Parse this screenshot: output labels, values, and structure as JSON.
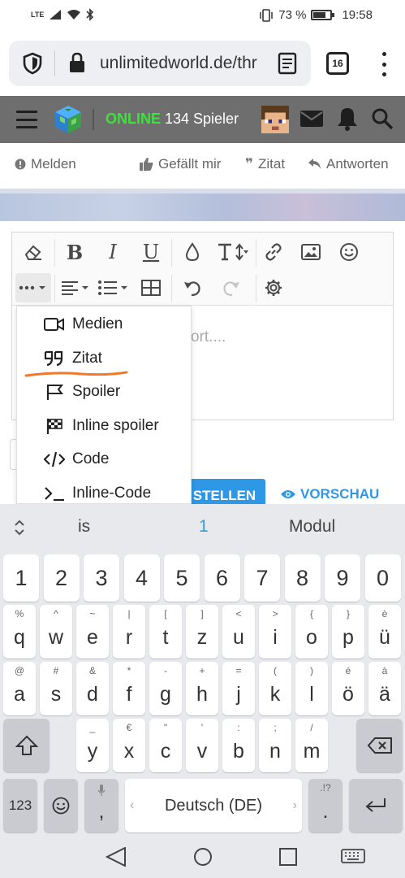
{
  "status_bar": {
    "network": "LTE",
    "battery": "73 %",
    "battery_level": 0.73,
    "time": "19:58"
  },
  "browser": {
    "url": "unlimitedworld.de/thr",
    "tab_count": "16",
    "icons": [
      "shield-icon",
      "lock-icon",
      "reader-mode-icon",
      "tabs-icon",
      "more-icon"
    ]
  },
  "site_header": {
    "online_label": "ONLINE",
    "players_text": "134 Spieler",
    "online_color": "#3be33b"
  },
  "post_actions": {
    "report": "Melden",
    "like": "Gefällt mir",
    "quote": "Zitat",
    "reply": "Antworten"
  },
  "editor": {
    "placeholder_fragment": "ort....",
    "toolbar_icons": [
      "eraser-icon",
      "bold-icon",
      "italic-icon",
      "underline-icon",
      "color-drop-icon",
      "text-size-icon",
      "link-icon",
      "image-icon",
      "smiley-icon",
      "more-options-icon",
      "align-icon",
      "list-icon",
      "table-icon",
      "undo-icon",
      "redo-icon",
      "settings-icon"
    ],
    "toolbar_glyphs": {
      "bold": "B",
      "italic": "I",
      "underline": "U"
    }
  },
  "dropdown_menu": {
    "items": [
      {
        "label": "Medien",
        "icon": "video-icon"
      },
      {
        "label": "Zitat",
        "icon": "quote-icon"
      },
      {
        "label": "Spoiler",
        "icon": "flag-icon"
      },
      {
        "label": "Inline spoiler",
        "icon": "checkered-flag-icon"
      },
      {
        "label": "Code",
        "icon": "code-icon"
      },
      {
        "label": "Inline-Code",
        "icon": "terminal-icon"
      }
    ],
    "highlight_color": "#f07a2a"
  },
  "form_buttons": {
    "submit_fragment": "STELLEN",
    "preview": "VORSCHAU",
    "accent_color": "#2f98e6"
  },
  "keyboard": {
    "suggestions": [
      "is",
      "1",
      "Modul"
    ],
    "number_row": [
      "1",
      "2",
      "3",
      "4",
      "5",
      "6",
      "7",
      "8",
      "9",
      "0"
    ],
    "row1": [
      {
        "main": "q",
        "sub": "%"
      },
      {
        "main": "w",
        "sub": "^"
      },
      {
        "main": "e",
        "sub": "~"
      },
      {
        "main": "r",
        "sub": "|"
      },
      {
        "main": "t",
        "sub": "["
      },
      {
        "main": "z",
        "sub": "]"
      },
      {
        "main": "u",
        "sub": "<"
      },
      {
        "main": "i",
        "sub": ">"
      },
      {
        "main": "o",
        "sub": "{"
      },
      {
        "main": "p",
        "sub": "}"
      },
      {
        "main": "ü",
        "sub": "è"
      }
    ],
    "row2": [
      {
        "main": "a",
        "sub": "@"
      },
      {
        "main": "s",
        "sub": "#"
      },
      {
        "main": "d",
        "sub": "&"
      },
      {
        "main": "f",
        "sub": "*"
      },
      {
        "main": "g",
        "sub": "-"
      },
      {
        "main": "h",
        "sub": "+"
      },
      {
        "main": "j",
        "sub": "="
      },
      {
        "main": "k",
        "sub": "("
      },
      {
        "main": "l",
        "sub": ")"
      },
      {
        "main": "ö",
        "sub": "é"
      },
      {
        "main": "ä",
        "sub": "à"
      }
    ],
    "row3": [
      {
        "main": "y",
        "sub": "_"
      },
      {
        "main": "x",
        "sub": "€"
      },
      {
        "main": "c",
        "sub": "\""
      },
      {
        "main": "v",
        "sub": "'"
      },
      {
        "main": "b",
        "sub": ":"
      },
      {
        "main": "n",
        "sub": ";"
      },
      {
        "main": "m",
        "sub": "/"
      }
    ],
    "symbols_key": "123",
    "comma": ",",
    "space_label": "Deutsch (DE)",
    "period": ".",
    "period_sub": ".!?"
  }
}
